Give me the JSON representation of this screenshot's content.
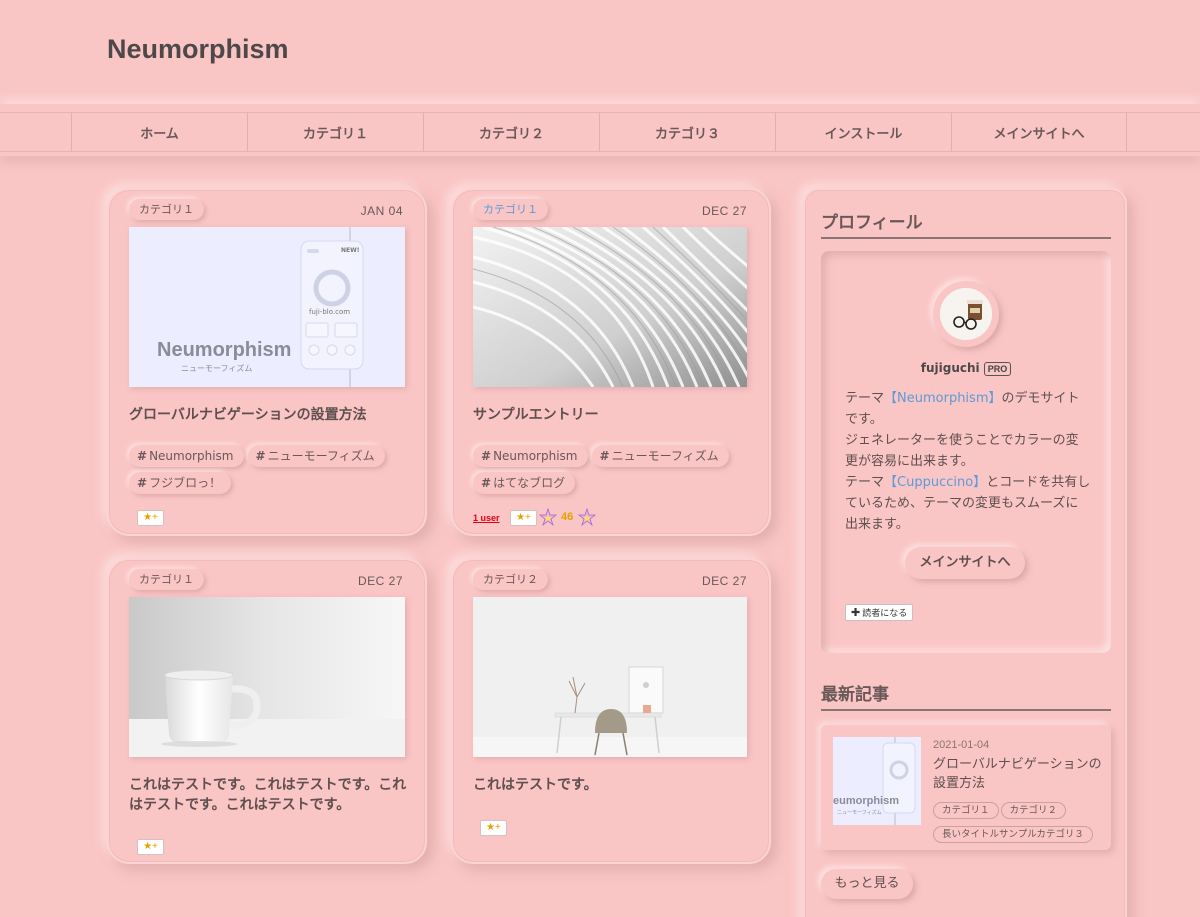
{
  "site": {
    "title": "Neumorphism"
  },
  "nav": {
    "items": [
      "ホーム",
      "カテゴリ１",
      "カテゴリ２",
      "カテゴリ３",
      "インストール",
      "メインサイトへ"
    ]
  },
  "posts": [
    {
      "category": "カテゴリ１",
      "date": "JAN 04",
      "title": "グローバルナビゲーションの設置方法",
      "tags": [
        "Neumorphism",
        "ニューモーフィズム",
        "フジブロっ！"
      ],
      "thumb": {
        "brand": "Neumorphism",
        "sub": "ニューモーフィズム",
        "url_text": "fuji-blo.com",
        "new_text": "NEW!"
      },
      "star_label": "★+"
    },
    {
      "category": "カテゴリ１",
      "date": "DEC 27",
      "title": "サンプルエントリー",
      "tags": [
        "Neumorphism",
        "ニューモーフィズム",
        "はてなブログ"
      ],
      "bookmark_users": "1 user",
      "star_label": "★+",
      "star_count": "46"
    },
    {
      "category": "カテゴリ１",
      "date": "DEC 27",
      "title": "これはテストです。これはテストです。これはテストです。これはテストです。",
      "star_label": "★+"
    },
    {
      "category": "カテゴリ２",
      "date": "DEC 27",
      "title": "これはテストです。",
      "star_label": "★+"
    }
  ],
  "sidebar": {
    "profile_heading": "プロフィール",
    "username": "fujiguchi",
    "pro_badge": "PRO",
    "profile_lines": {
      "p1_pre": "テーマ",
      "p1_link": "【Neumorphism】",
      "p1_post": "のデモサイトです。",
      "p2": "ジェネレーターを使うことでカラーの変更が容易に出来ます。",
      "p3_pre": "テーマ",
      "p3_link": "【Cuppuccino】",
      "p3_post": "とコードを共有しているため、テーマの変更もスムーズに出来ます。"
    },
    "main_site_button": "メインサイトへ",
    "reader_button": "読者になる",
    "recent_heading": "最新記事",
    "recent": {
      "date": "2021-01-04",
      "title": "グローバルナビゲーションの設置方法",
      "categories": [
        "カテゴリ１",
        "カテゴリ２",
        "長いタイトルサンプルカテゴリ３"
      ],
      "thumb_brand": "eumorphism",
      "thumb_sub": "ニューモーフィズム"
    },
    "more_button": "もっと見る"
  },
  "colors": {
    "background": "#fac5c5",
    "link": "#5b9bd8",
    "star": "#e6a000",
    "bookmark": "#e60012"
  }
}
